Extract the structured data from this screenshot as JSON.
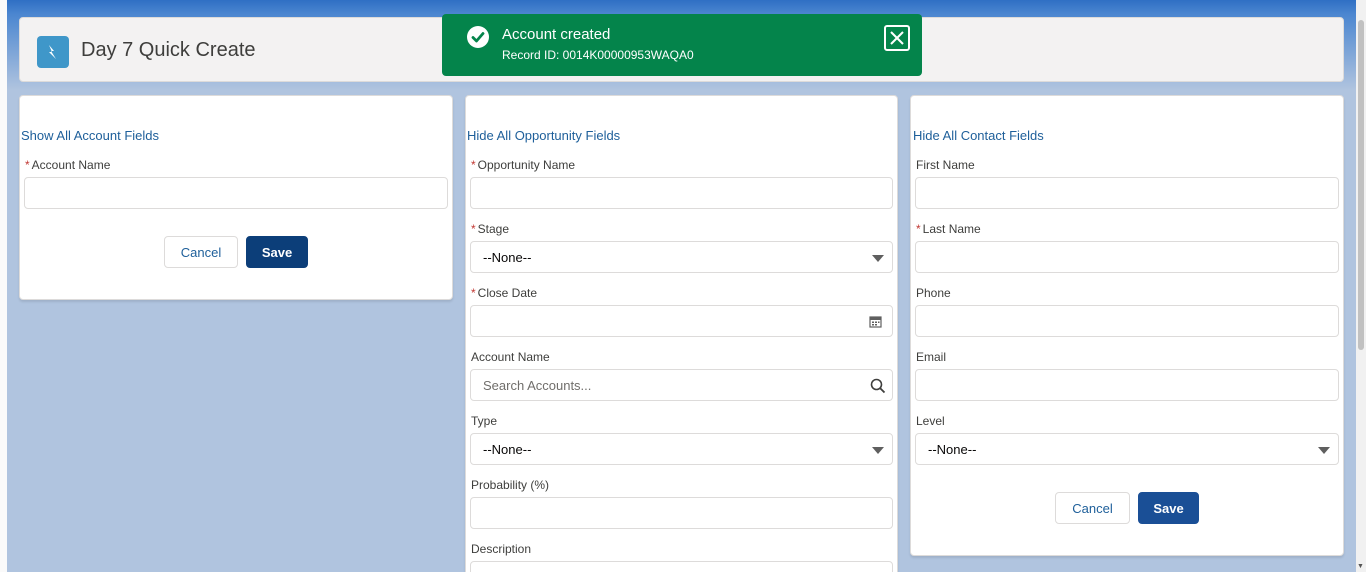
{
  "header": {
    "title": "Day 7 Quick Create",
    "icon": "quick-create-icon"
  },
  "toast": {
    "title": "Account created",
    "record_id": "Record ID: 0014K00000953WAQA0",
    "color": "#04844b"
  },
  "account": {
    "toggle_link": "Show All Account Fields",
    "name_label": "Account Name",
    "cancel": "Cancel",
    "save": "Save"
  },
  "opportunity": {
    "toggle_link": "Hide All Opportunity Fields",
    "name_label": "Opportunity Name",
    "stage_label": "Stage",
    "stage_value": "--None--",
    "close_date_label": "Close Date",
    "account_name_label": "Account Name",
    "account_search_placeholder": "Search Accounts...",
    "type_label": "Type",
    "type_value": "--None--",
    "probability_label": "Probability (%)",
    "description_label": "Description"
  },
  "contact": {
    "toggle_link": "Hide All Contact Fields",
    "first_name_label": "First Name",
    "last_name_label": "Last Name",
    "phone_label": "Phone",
    "email_label": "Email",
    "level_label": "Level",
    "level_value": "--None--",
    "cancel": "Cancel",
    "save": "Save"
  },
  "required_marker": "*",
  "colors": {
    "link": "#1e5f9a",
    "brand_button": "#0c3e79",
    "required": "#c23934"
  }
}
